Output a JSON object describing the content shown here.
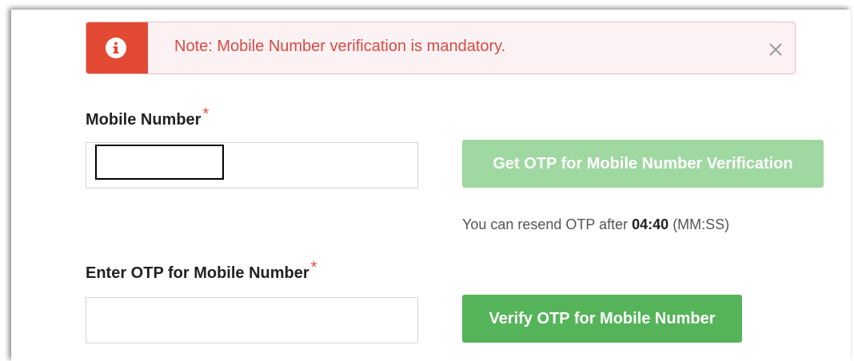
{
  "alert": {
    "icon": "info-icon",
    "message": "Note: Mobile Number verification is mandatory.",
    "close_icon": "close-icon"
  },
  "mobile": {
    "label": "Mobile Number",
    "required_mark": "*",
    "value": "",
    "get_otp_label": "Get OTP for Mobile Number Verification"
  },
  "resend": {
    "prefix": "You can resend OTP after ",
    "time": "04:40",
    "suffix": " (MM:SS)"
  },
  "otp": {
    "label": "Enter OTP for Mobile Number",
    "required_mark": "*",
    "value": "",
    "verify_label": "Verify OTP for Mobile Number"
  },
  "colors": {
    "alert_accent": "#e24a34",
    "alert_text": "#d74b45",
    "button_disabled": "#9fd8a1",
    "button_active": "#55b459"
  }
}
